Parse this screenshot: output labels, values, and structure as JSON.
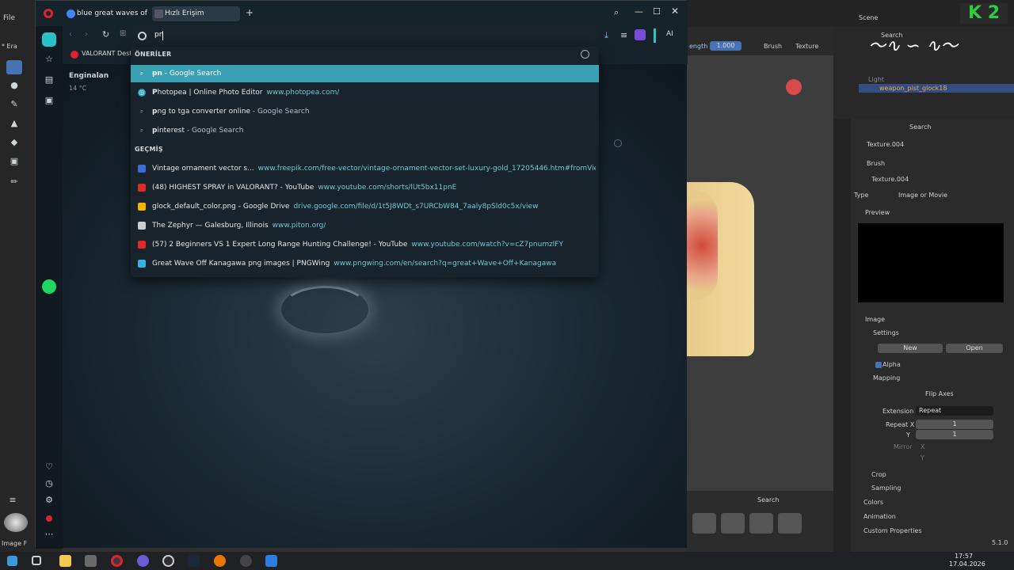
{
  "blender": {
    "menu_file": "File",
    "left_label": "* Era",
    "left_bottom_label": "Image F",
    "scene_label": "Scene",
    "search_placeholder": "Search",
    "outliner_items": [
      "Light",
      "weapon_pist_glock18"
    ],
    "viewport_length_label": "ength",
    "viewport_length_value": "1.000",
    "viewport_brush": "Brush",
    "viewport_texture": "Texture",
    "props": {
      "texture_name": "Texture.004",
      "brush_label": "Brush",
      "texture_slot": "Texture.004",
      "type_label": "Type",
      "type_value": "Image or Movie",
      "preview_label": "Preview",
      "image_label": "Image",
      "settings_label": "Settings",
      "new_label": "New",
      "open_label": "Open",
      "alpha_label": "Alpha",
      "mapping_label": "Mapping",
      "flip_axes_label": "Flip Axes",
      "extension_label": "Extension",
      "extension_value": "Repeat",
      "repeat_x_label": "Repeat X",
      "repeat_x_value": "1",
      "y_label": "Y",
      "y_value": "1",
      "mirror_label": "Mirror",
      "mirror_x": "X",
      "mirror_y": "Y",
      "crop_label": "Crop",
      "sampling_label": "Sampling",
      "colors_label": "Colors",
      "animation_label": "Animation",
      "custom_props_label": "Custom Properties"
    },
    "version": "5.1.0",
    "bottom_search": "Search"
  },
  "opera": {
    "tabs": [
      {
        "label": "blue great waves of kana..."
      },
      {
        "label": "Hızlı Erişim"
      }
    ],
    "address_value": "pn",
    "bookmark": "VALORANT Deste",
    "weather_city": "Enginalan",
    "weather_temp": "14 °C",
    "ai_label": "AI"
  },
  "dropdown": {
    "suggestions_header": "ÖNERİLER",
    "history_header": "GEÇMİŞ",
    "suggestions": [
      {
        "bold": "pn",
        "rest": "",
        "suffix": " - Google Search",
        "url": "",
        "icon": "search-icon"
      },
      {
        "bold": "P",
        "rest": "hotopea | Online Photo Editor",
        "suffix": "",
        "url": "www.photopea.com/",
        "icon": "photopea-icon"
      },
      {
        "bold": "p",
        "rest": "ng to tga converter online",
        "suffix": " - Google Search",
        "url": "",
        "icon": "search-icon"
      },
      {
        "bold": "p",
        "rest": "interest",
        "suffix": " - Google Search",
        "url": "",
        "icon": "search-icon"
      }
    ],
    "history": [
      {
        "title": "Vintage ornament vector s...",
        "url": "www.freepik.com/free-vector/vintage-ornament-vector-set-luxury-gold_17205446.htm#fromView=search&page=1...",
        "color": "#3f6bd6"
      },
      {
        "title": "(48) HIGHEST SPRAY in VALORANT? - YouTube",
        "url": "www.youtube.com/shorts/lUt5bx11pnE",
        "color": "#e02a2a"
      },
      {
        "title": "glock_default_color.png - Google Drive",
        "url": "drive.google.com/file/d/1t5J8WDt_s7URCbW84_7aaly8pSld0c5x/view",
        "color": "#f2b400"
      },
      {
        "title": "The Zephyr — Galesburg, Illinois",
        "url": "www.piton.org/",
        "color": "#cccccc"
      },
      {
        "title": "(57) 2 Beginners VS 1 Expert Long Range Hunting Challenge! - YouTube",
        "url": "www.youtube.com/watch?v=cZ7pnumzlFY",
        "color": "#e02a2a"
      },
      {
        "title": "Great Wave Off Kanagawa png images | PNGWing",
        "url": "www.pngwing.com/en/search?q=great+Wave+Off+Kanagawa",
        "color": "#36b3e0"
      }
    ]
  },
  "taskbar": {
    "time": "17:57",
    "date": "17.04.2026"
  },
  "colors": {
    "accent": "#3aa0b3",
    "opera_red": "#e0222f"
  }
}
